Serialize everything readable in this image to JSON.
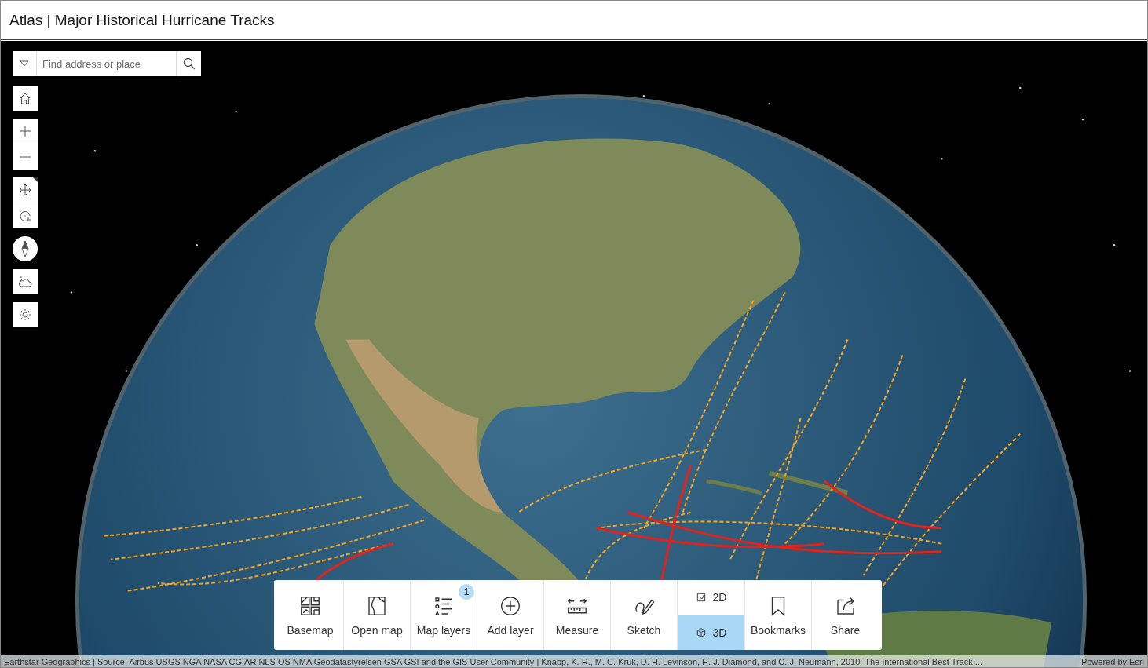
{
  "title": "Atlas | Major Historical Hurricane Tracks",
  "search": {
    "placeholder": "Find address or place"
  },
  "toolbar": [
    {
      "kind": "button",
      "label": "Basemap"
    },
    {
      "kind": "button",
      "label": "Open map"
    },
    {
      "kind": "button",
      "label": "Map layers",
      "badge": "1"
    },
    {
      "kind": "button",
      "label": "Add layer"
    },
    {
      "kind": "button",
      "label": "Measure"
    },
    {
      "kind": "button",
      "label": "Sketch"
    },
    {
      "kind": "toggle",
      "options": [
        {
          "label": "2D",
          "selected": false
        },
        {
          "label": "3D",
          "selected": true
        }
      ]
    },
    {
      "kind": "button",
      "label": "Bookmarks"
    },
    {
      "kind": "button",
      "label": "Share"
    }
  ],
  "attribution": {
    "credits": "Earthstar Geographics | Source: Airbus USGS NGA NASA CGIAR NLS OS NMA Geodatastyrelsen GSA GSI and the GIS User Community | Knapp, K. R., M. C. Kruk, D. H. Levinson, H. J. Diamond, and C. J. Neumann, 2010: The International Best Track ...",
    "powered_by": "Powered by Esri"
  }
}
